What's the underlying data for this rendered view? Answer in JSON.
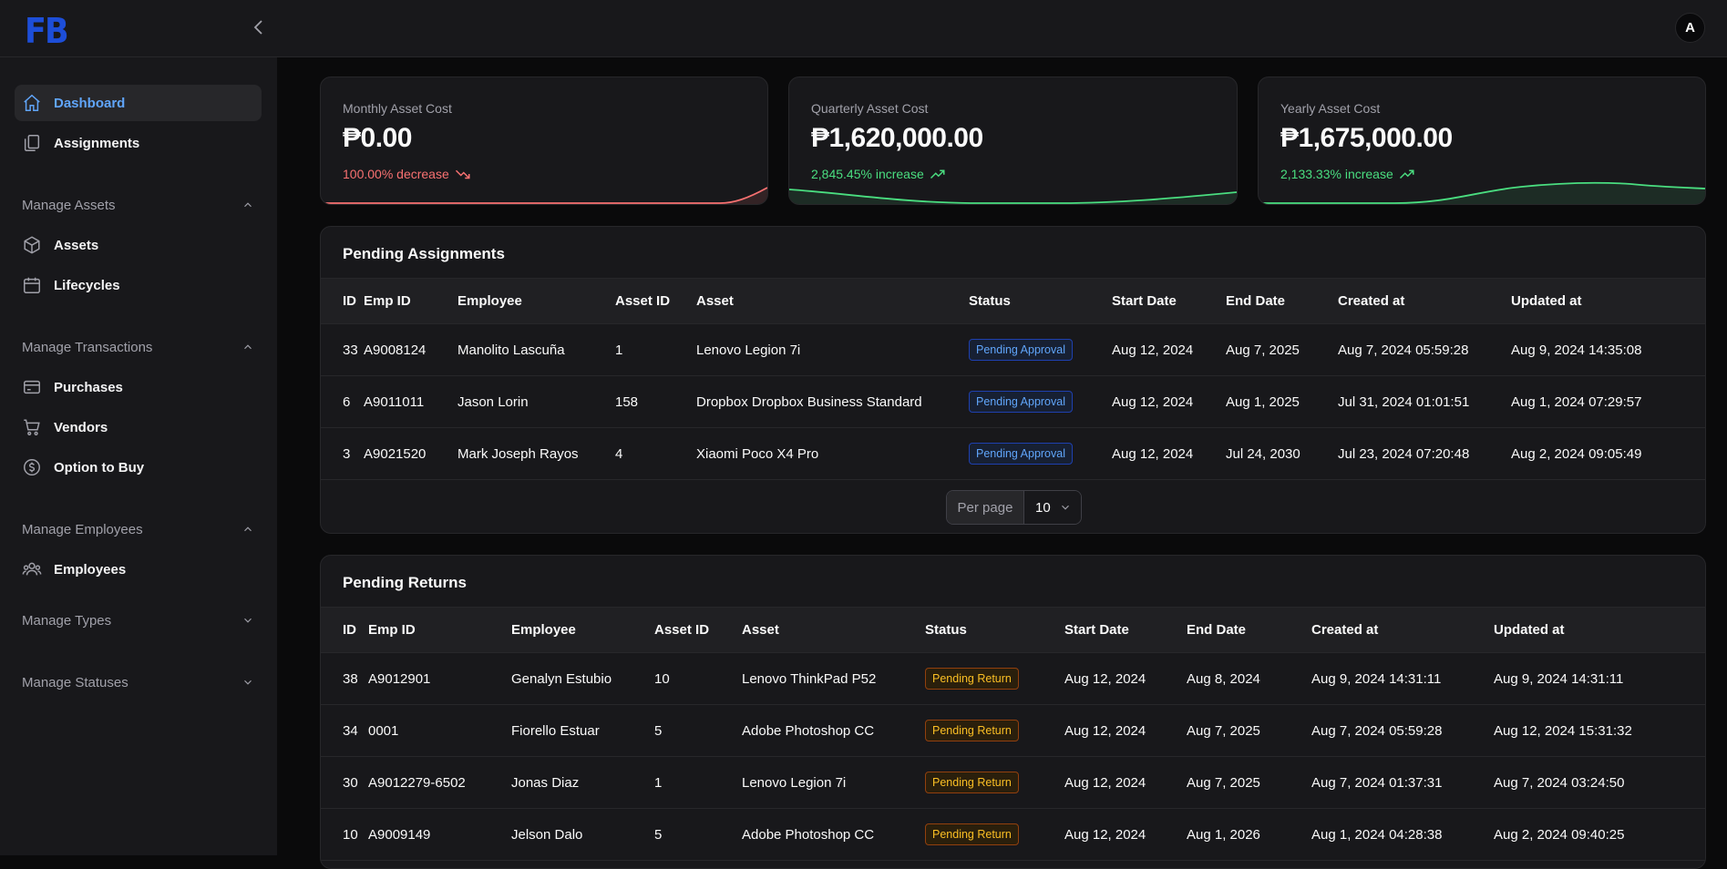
{
  "app": {
    "logo": "FB",
    "avatar_initial": "A"
  },
  "sidebar": {
    "dashboard": "Dashboard",
    "assignments": "Assignments",
    "groups": {
      "assets": "Manage Assets",
      "transactions": "Manage Transactions",
      "employees": "Manage Employees",
      "types": "Manage Types",
      "statuses": "Manage Statuses"
    },
    "assets": "Assets",
    "lifecycles": "Lifecycles",
    "purchases": "Purchases",
    "vendors": "Vendors",
    "option_to_buy": "Option to Buy",
    "employees": "Employees"
  },
  "stats": [
    {
      "label": "Monthly Asset Cost",
      "value": "₱0.00",
      "trend": "100.00% decrease",
      "direction": "down",
      "color": "#f87171"
    },
    {
      "label": "Quarterly Asset Cost",
      "value": "₱1,620,000.00",
      "trend": "2,845.45% increase",
      "direction": "up",
      "color": "#4ade80"
    },
    {
      "label": "Yearly Asset Cost",
      "value": "₱1,675,000.00",
      "trend": "2,133.33% increase",
      "direction": "up",
      "color": "#4ade80"
    }
  ],
  "pending_assignments": {
    "title": "Pending Assignments",
    "columns": [
      "ID",
      "Emp ID",
      "Employee",
      "Asset ID",
      "Asset",
      "Status",
      "Start Date",
      "End Date",
      "Created at",
      "Updated at"
    ],
    "rows": [
      [
        "33",
        "A9008124",
        "Manolito Lascuña",
        "1",
        "Lenovo Legion 7i",
        "Pending Approval",
        "Aug 12, 2024",
        "Aug 7, 2025",
        "Aug 7, 2024 05:59:28",
        "Aug 9, 2024 14:35:08"
      ],
      [
        "6",
        "A9011011",
        "Jason Lorin",
        "158",
        "Dropbox Dropbox Business Standard",
        "Pending Approval",
        "Aug 12, 2024",
        "Aug 1, 2025",
        "Jul 31, 2024 01:01:51",
        "Aug 1, 2024 07:29:57"
      ],
      [
        "3",
        "A9021520",
        "Mark Joseph Rayos",
        "4",
        "Xiaomi Poco X4 Pro",
        "Pending Approval",
        "Aug 12, 2024",
        "Jul 24, 2030",
        "Jul 23, 2024 07:20:48",
        "Aug 2, 2024 09:05:49"
      ]
    ],
    "per_page_label": "Per page",
    "per_page_value": "10"
  },
  "pending_returns": {
    "title": "Pending Returns",
    "columns": [
      "ID",
      "Emp ID",
      "Employee",
      "Asset ID",
      "Asset",
      "Status",
      "Start Date",
      "End Date",
      "Created at",
      "Updated at"
    ],
    "rows": [
      [
        "38",
        "A9012901",
        "Genalyn Estubio",
        "10",
        "Lenovo ThinkPad P52",
        "Pending Return",
        "Aug 12, 2024",
        "Aug 8, 2024",
        "Aug 9, 2024 14:31:11",
        "Aug 9, 2024 14:31:11"
      ],
      [
        "34",
        "0001",
        "Fiorello Estuar",
        "5",
        "Adobe Photoshop CC",
        "Pending Return",
        "Aug 12, 2024",
        "Aug 7, 2025",
        "Aug 7, 2024 05:59:28",
        "Aug 12, 2024 15:31:32"
      ],
      [
        "30",
        "A9012279-6502",
        "Jonas Diaz",
        "1",
        "Lenovo Legion 7i",
        "Pending Return",
        "Aug 12, 2024",
        "Aug 7, 2025",
        "Aug 7, 2024 01:37:31",
        "Aug 7, 2024 03:24:50"
      ],
      [
        "10",
        "A9009149",
        "Jelson Dalo",
        "5",
        "Adobe Photoshop CC",
        "Pending Return",
        "Aug 12, 2024",
        "Aug 1, 2026",
        "Aug 1, 2024 04:28:38",
        "Aug 2, 2024 09:40:25"
      ]
    ]
  }
}
